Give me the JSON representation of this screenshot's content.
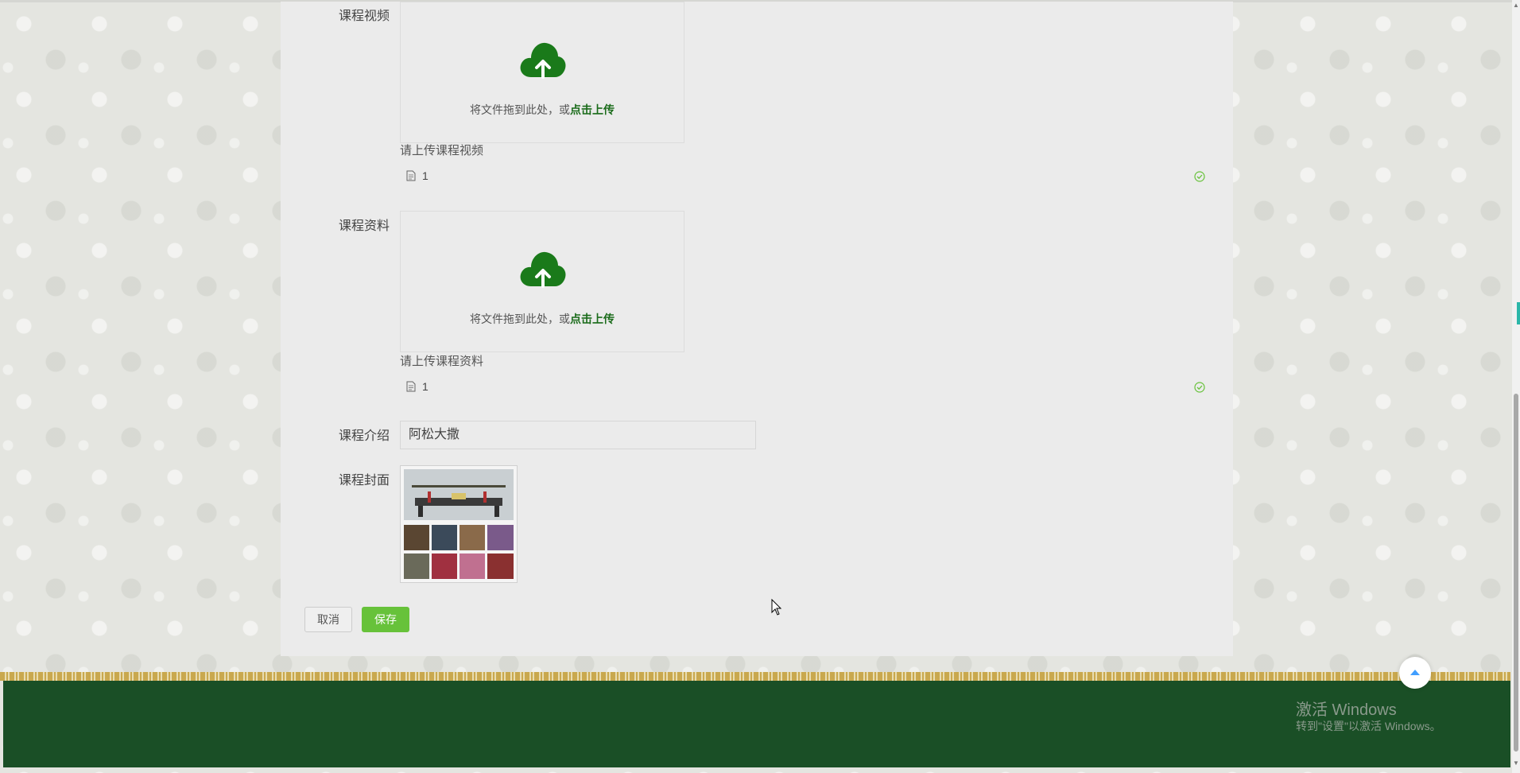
{
  "form": {
    "video": {
      "label": "课程视频",
      "drop_text": "将文件拖到此处，或",
      "drop_link": "点击上传",
      "tip": "请上传课程视频",
      "file_name": "1"
    },
    "material": {
      "label": "课程资料",
      "drop_text": "将文件拖到此处，或",
      "drop_link": "点击上传",
      "tip": "请上传课程资料",
      "file_name": "1"
    },
    "intro": {
      "label": "课程介绍",
      "value": "阿松大撒"
    },
    "cover": {
      "label": "课程封面"
    },
    "buttons": {
      "cancel": "取消",
      "save": "保存"
    }
  },
  "watermark": {
    "title": "激活 Windows",
    "subtitle": "转到\"设置\"以激活 Windows。"
  },
  "icons": {
    "upload": "upload-cloud-icon",
    "file": "file-icon",
    "success": "circle-check-icon",
    "back_top": "caret-up-icon"
  },
  "colors": {
    "accent_green": "#1a6b1a",
    "save_button": "#67c23a",
    "footer": "#1a4f26",
    "success": "#67c23a"
  }
}
